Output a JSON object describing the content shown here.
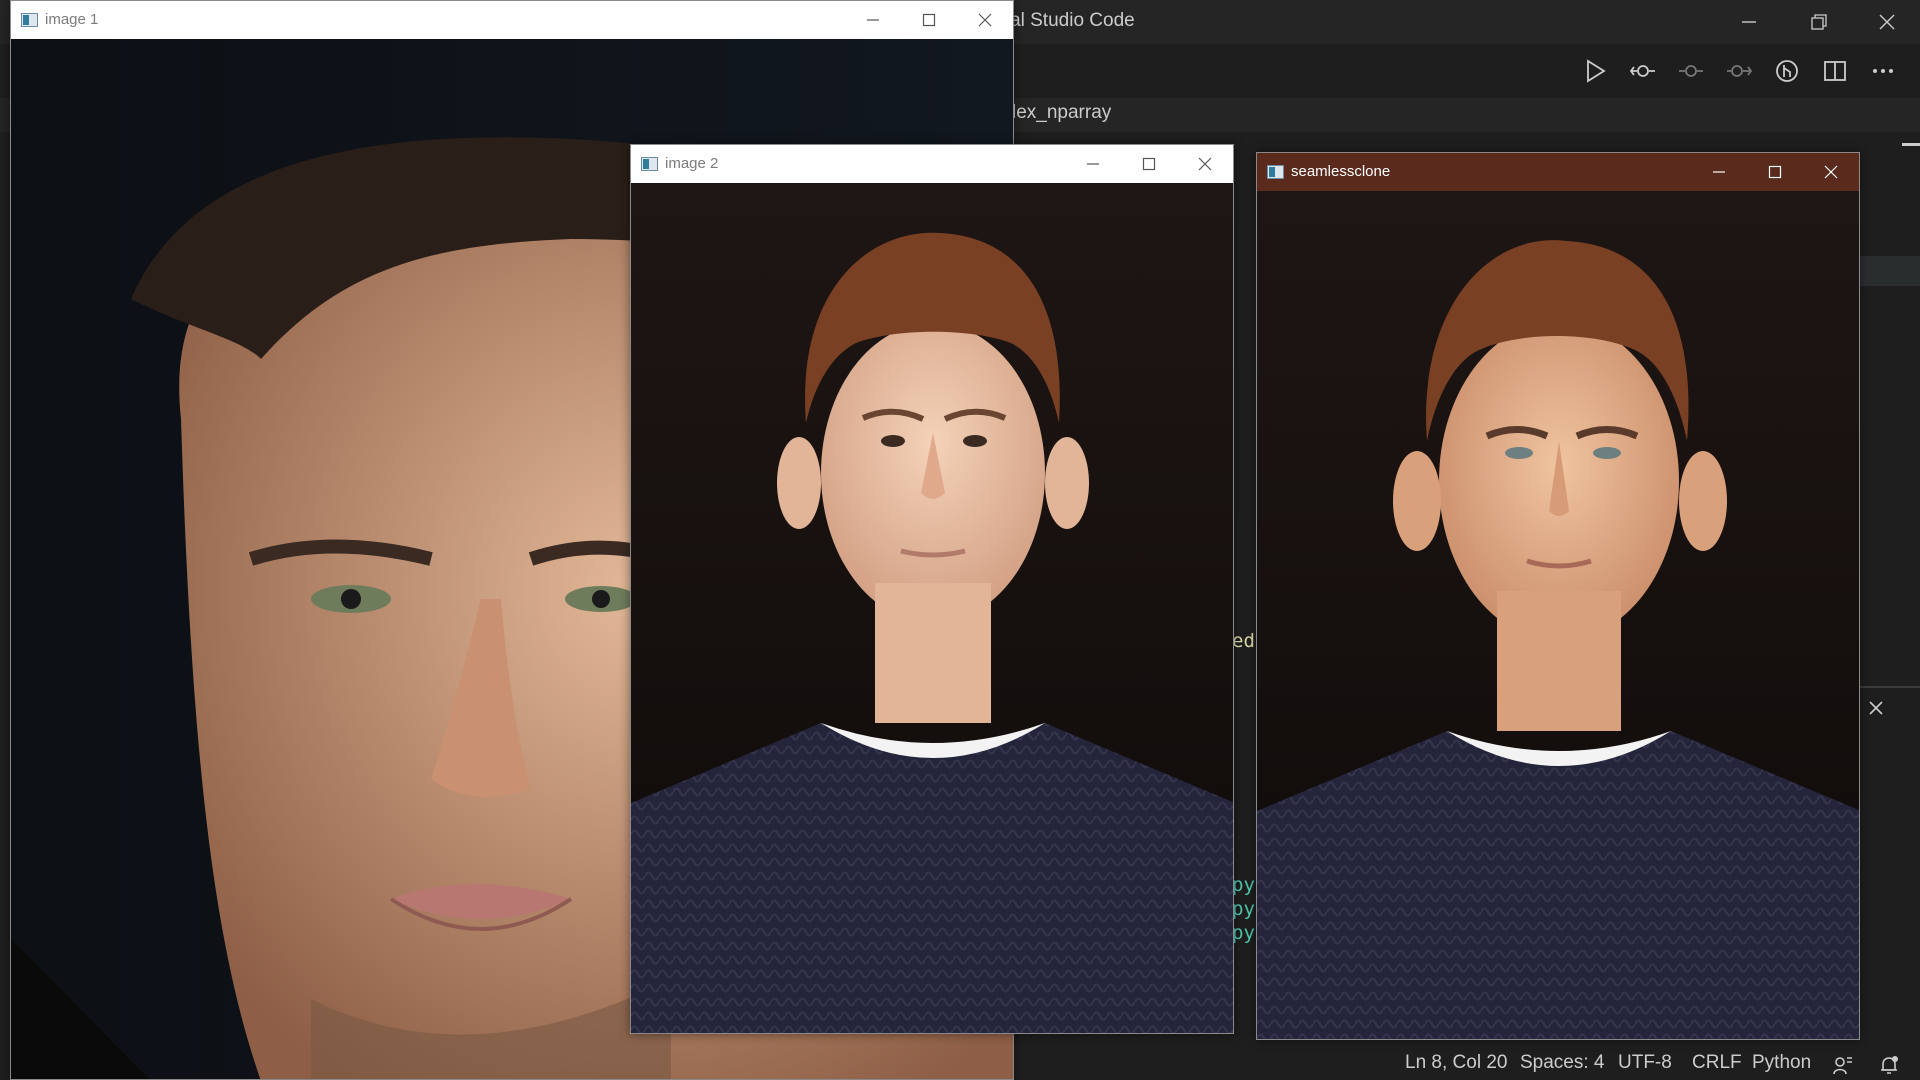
{
  "vscode": {
    "title": "sual Studio Code",
    "tab_label": "lex_nparray",
    "code_fragments": [
      "ed",
      "py",
      "py",
      "py"
    ],
    "status": {
      "position": "Ln 8, Col 20",
      "spaces": "Spaces: 4",
      "encoding": "UTF-8",
      "eol": "CRLF",
      "language": "Python"
    },
    "icons": [
      "run-icon",
      "split-icon",
      "more-icon",
      "feedback-icon",
      "bell-icon"
    ],
    "colors": {
      "background": "#1e1e1e",
      "code_yellow": "#dcdcaa",
      "code_teal": "#4ec9b0"
    }
  },
  "windows": [
    {
      "title": "image 1"
    },
    {
      "title": "image 2"
    },
    {
      "title": "seamlessclone"
    }
  ],
  "colors": {
    "active_titlebar": "#5a2a1d"
  }
}
